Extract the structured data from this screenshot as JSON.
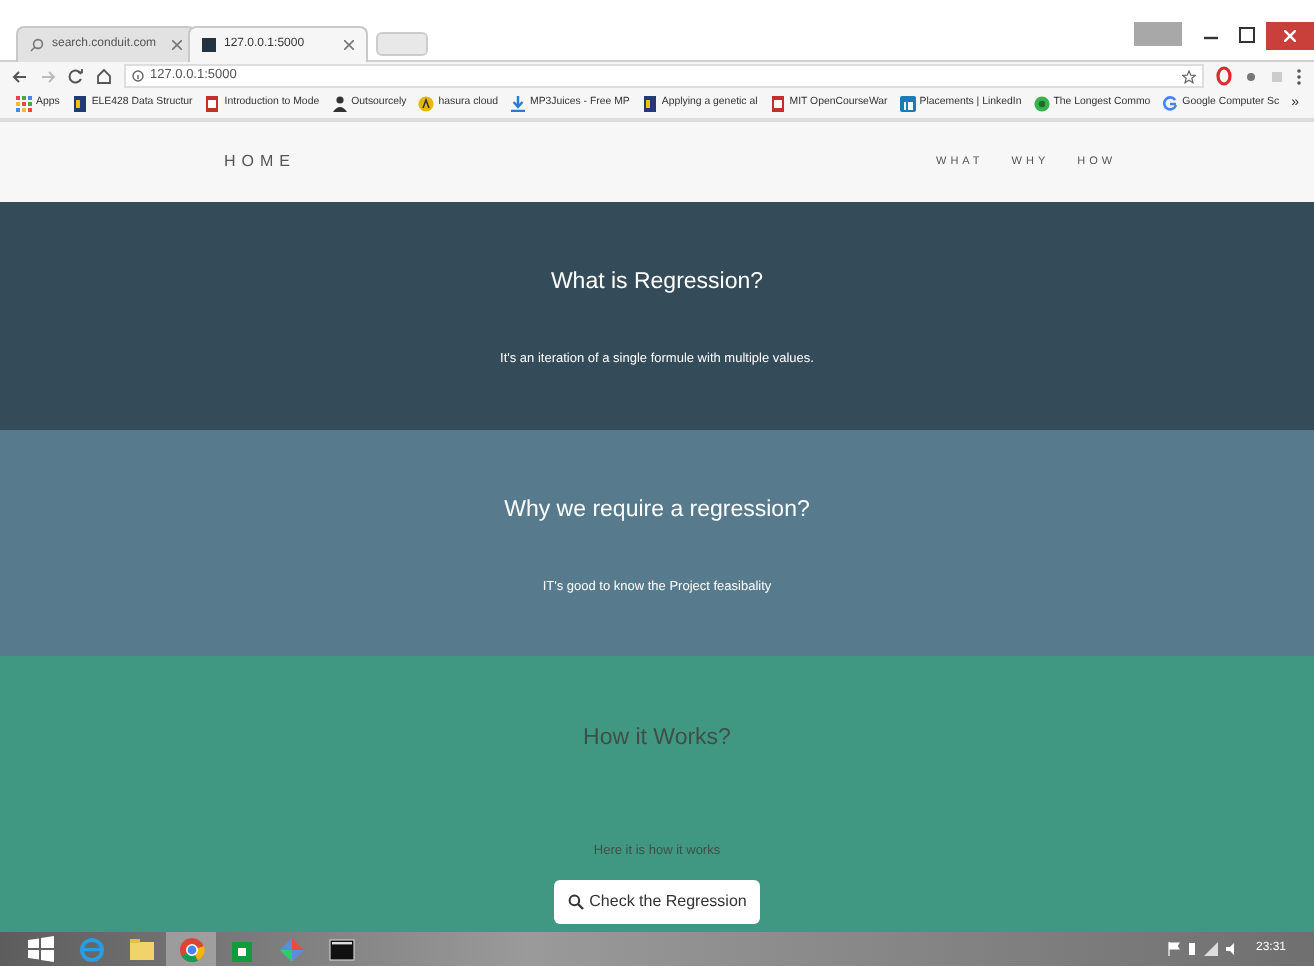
{
  "browser": {
    "tabs": [
      {
        "title": "search.conduit.com",
        "kind": "search",
        "selected": false
      },
      {
        "title": "127.0.0.1:5000",
        "kind": "page",
        "selected": true
      }
    ],
    "address": "127.0.0.1:5000",
    "bookmarks": [
      {
        "label": "Apps",
        "kind": "apps"
      },
      {
        "label": "ELE428 Data Structur",
        "kind": "doc"
      },
      {
        "label": "Introduction to Mode",
        "kind": "book"
      },
      {
        "label": "Outsourcely",
        "kind": "person"
      },
      {
        "label": "hasura cloud",
        "kind": "coin"
      },
      {
        "label": "MP3Juices - Free MP",
        "kind": "download"
      },
      {
        "label": "Applying a genetic al",
        "kind": "doc"
      },
      {
        "label": "MIT OpenCourseWar",
        "kind": "book"
      },
      {
        "label": "Placements | LinkedIn",
        "kind": "linkedin"
      },
      {
        "label": "The Longest Commo",
        "kind": "circle"
      },
      {
        "label": "Google Computer Sc",
        "kind": "google"
      }
    ],
    "more": "»"
  },
  "nav": {
    "brand": "HOME",
    "links": [
      "WHAT",
      "WHY",
      "HOW"
    ]
  },
  "sections": [
    {
      "title": "What is Regression?",
      "text": "It's an iteration of a single formule with multiple values.",
      "color": "#344b5a",
      "dim_text": false
    },
    {
      "title": "Why we require a regression?",
      "text": "IT's good to know the Project feasibality",
      "color": "#577b8c",
      "dim_text": false
    },
    {
      "title": "How it Works?",
      "text": "Here it is how it works",
      "color": "#419882",
      "dim_text": true,
      "button": "Check the Regression"
    }
  ],
  "taskbar": {
    "apps": [
      {
        "kind": "explorer",
        "selected": false
      },
      {
        "kind": "folder",
        "selected": false
      },
      {
        "kind": "chrome",
        "selected": true
      },
      {
        "kind": "store",
        "selected": false
      },
      {
        "kind": "diamond",
        "selected": false
      },
      {
        "kind": "terminal",
        "selected": false
      }
    ],
    "clock": "23:31"
  }
}
